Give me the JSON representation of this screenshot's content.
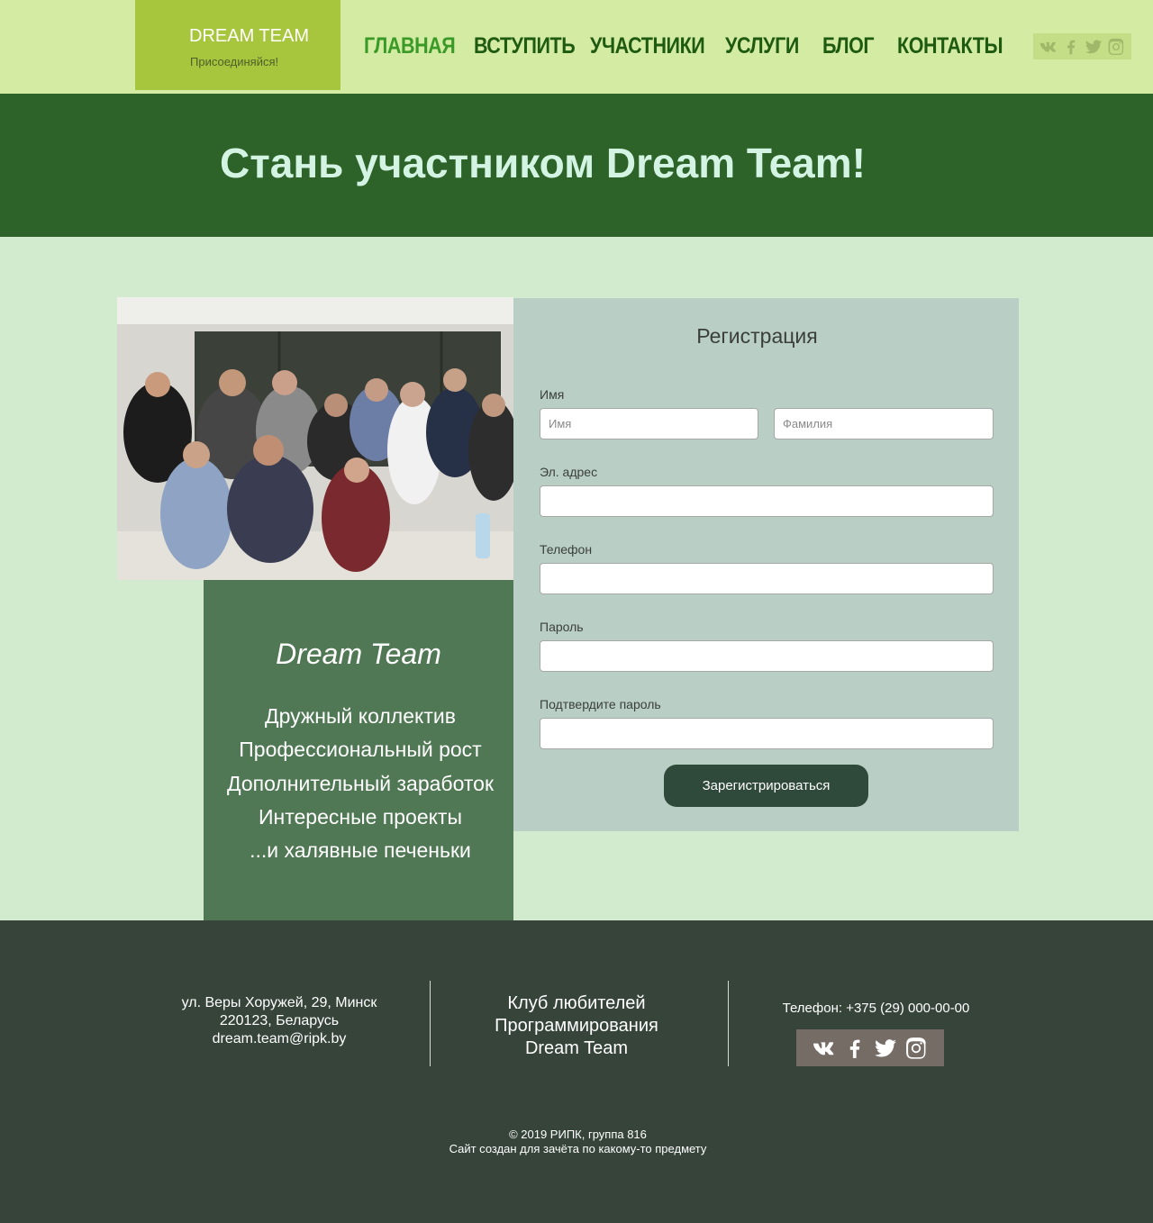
{
  "header": {
    "logo_title": "DREAM TEAM",
    "logo_subtitle": "Присоединяйся!",
    "nav": [
      {
        "label": "ГЛАВНАЯ",
        "active": true
      },
      {
        "label": "ВСТУПИТЬ",
        "active": false
      },
      {
        "label": "УЧАСТНИКИ",
        "active": false
      },
      {
        "label": "УСЛУГИ",
        "active": false
      },
      {
        "label": "БЛОГ",
        "active": false
      },
      {
        "label": "КОНТАКТЫ",
        "active": false
      }
    ],
    "social_icons": [
      "vk-icon",
      "facebook-icon",
      "twitter-icon",
      "instagram-icon"
    ]
  },
  "hero": {
    "title": "Стань участником Dream Team!"
  },
  "about": {
    "title": "Dream Team",
    "points": [
      "Дружный коллектив",
      "Профессиональный рост",
      "Дополнительный заработок",
      "Интересные проекты",
      "...и халявные печеньки"
    ]
  },
  "form": {
    "title": "Регистрация",
    "name_label": "Имя",
    "first_name_placeholder": "Имя",
    "last_name_placeholder": "Фамилия",
    "email_label": "Эл. адрес",
    "phone_label": "Телефон",
    "password_label": "Пароль",
    "confirm_label": "Подтвердите пароль",
    "submit_label": "Зарегистрироваться"
  },
  "footer": {
    "address_line1": "ул. Веры Хоружей, 29, Минск",
    "address_line2": "220123, Беларусь",
    "email": "dream.team@ripk.by",
    "club_line1": "Клуб любителей",
    "club_line2": "Программирования",
    "club_line3": "Dream Team",
    "phone": "Телефон: +375 (29) 000-00-00",
    "copyright": "© 2019 РИПК, группа 816",
    "note": "Сайт создан для зачёта по какому-то предмету"
  },
  "colors": {
    "header_bg": "#d4eba3",
    "logo_bg": "#a8c63d",
    "nav_text": "#1e5b11",
    "nav_active": "#3a9a27",
    "hero_bg": "#2d6329",
    "hero_text": "#d3f3e3",
    "page_bg": "#d2ebce",
    "about_bg": "#507854",
    "form_bg": "#b9cec4",
    "button_bg": "#2f4a3a",
    "footer_bg": "#36443a"
  }
}
